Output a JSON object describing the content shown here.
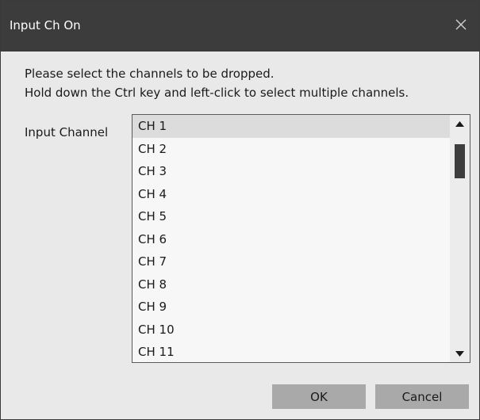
{
  "dialog": {
    "title": "Input Ch On",
    "close_icon": "close-icon"
  },
  "instructions": {
    "line1": "Please select the channels to be dropped.",
    "line2": "Hold down the Ctrl key and left-click to select multiple channels."
  },
  "channel_list": {
    "label": "Input Channel",
    "selected_index": 0,
    "items": [
      "CH 1",
      "CH 2",
      "CH 3",
      "CH 4",
      "CH 5",
      "CH 6",
      "CH 7",
      "CH 8",
      "CH 9",
      "CH 10",
      "CH 11"
    ],
    "scroll_up_icon": "scroll-up-arrow-icon",
    "scroll_down_icon": "scroll-down-arrow-icon"
  },
  "buttons": {
    "ok_label": "OK",
    "cancel_label": "Cancel"
  },
  "colors": {
    "titlebar": "#3c3c3c",
    "dialog_background": "#e9e9e9",
    "list_background": "#f7f7f7",
    "selected_item": "#dcdcdc",
    "button_background": "#a9a9a9",
    "scroll_thumb": "#3d3d3d"
  }
}
